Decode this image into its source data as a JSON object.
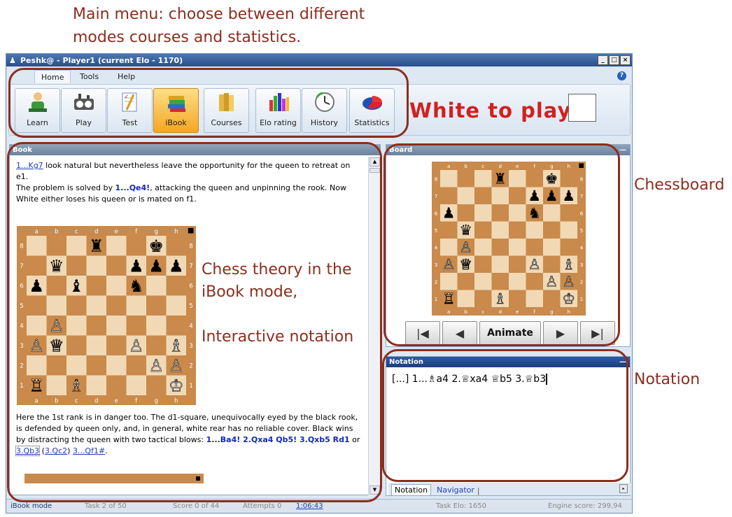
{
  "annotations": {
    "menu_line1": "Main menu: choose between different",
    "menu_line2": "modes courses and statistics.",
    "chessboard": "Chessboard",
    "notation": "Notation",
    "theory_line1": "Chess theory in  the",
    "theory_line2": "iBook mode,",
    "theory_line3": "Interactive notation"
  },
  "window": {
    "title": "Peshk@ - Player1 (current Elo - 1170)",
    "buttons": [
      "_",
      "□",
      "×"
    ]
  },
  "ribbon": {
    "tabs": [
      "Home",
      "Tools",
      "Help"
    ],
    "active_tab": "Home",
    "help_icon": "help-icon",
    "buttons": [
      {
        "label": "Learn",
        "icon": "learn-icon"
      },
      {
        "label": "Play",
        "icon": "clock-icon"
      },
      {
        "label": "Test",
        "icon": "test-icon"
      },
      {
        "label": "iBook",
        "icon": "books-icon"
      },
      {
        "label": "Courses",
        "icon": "course-books-icon"
      },
      {
        "label": "Elo rating",
        "icon": "bar-chart-icon"
      },
      {
        "label": "History",
        "icon": "history-clock-icon"
      },
      {
        "label": "Statistics",
        "icon": "pie-chart-icon"
      }
    ],
    "active_button": "iBook",
    "to_play": "White to play"
  },
  "book": {
    "title": "Book",
    "para1_link": "1...Kg7",
    "para1_rest": " look natural but nevertheless leave the opportunity for the queen to retreat on e1.",
    "para2_a": "The problem is solved by ",
    "para2_move": "1...Qe4!",
    "para2_b": ", attacking the queen and unpinning the rook. Now White either loses his queen or is mated on f1.",
    "para3": "Here the 1st rank is in danger too. The d1-square, unequivocally eyed by the black rook, is defended by queen only, and, in general, white rear has no reliable cover. Black wins by distracting the queen with two tactical blows: ",
    "para3_moves": "1...Ba4! 2.Qxa4 Qb5! 3.Qxb5 Rd1",
    "para3_or": " or ",
    "var1": "3.Qb3",
    "var2": "3.Qc2",
    "var3": "3...Qf1#",
    "period": "."
  },
  "board_panel": {
    "title": "Board",
    "animate": "Animate",
    "files": [
      "a",
      "b",
      "c",
      "d",
      "e",
      "f",
      "g",
      "h"
    ],
    "ranks": [
      "8",
      "7",
      "6",
      "5",
      "4",
      "3",
      "2",
      "1"
    ],
    "pieces": [
      [
        "d8",
        "r"
      ],
      [
        "g8",
        "k"
      ],
      [
        "b7",
        "q"
      ],
      [
        "f7",
        "p"
      ],
      [
        "g7",
        "p"
      ],
      [
        "h7",
        "p"
      ],
      [
        "a6",
        "p"
      ],
      [
        "c6",
        "b"
      ],
      [
        "f6",
        "n"
      ],
      [
        "b4",
        "P"
      ],
      [
        "a3",
        "P"
      ],
      [
        "b3",
        "Q"
      ],
      [
        "f3",
        "P"
      ],
      [
        "h3",
        "B"
      ],
      [
        "g2",
        "P"
      ],
      [
        "h2",
        "P"
      ],
      [
        "a1",
        "R"
      ],
      [
        "c1",
        "B"
      ],
      [
        "h1",
        "K"
      ]
    ],
    "small_pieces": [
      [
        "d8",
        "r"
      ],
      [
        "g8",
        "k"
      ],
      [
        "f7",
        "p"
      ],
      [
        "g7",
        "p"
      ],
      [
        "h7",
        "p"
      ],
      [
        "a6",
        "p"
      ],
      [
        "f6",
        "n"
      ],
      [
        "b5",
        "q"
      ],
      [
        "b4",
        "P"
      ],
      [
        "a3",
        "P"
      ],
      [
        "b3",
        "Q"
      ],
      [
        "f3",
        "P"
      ],
      [
        "h3",
        "B"
      ],
      [
        "g2",
        "P"
      ],
      [
        "h2",
        "P"
      ],
      [
        "a1",
        "R"
      ],
      [
        "d1",
        "B"
      ],
      [
        "h1",
        "K"
      ]
    ]
  },
  "notation_panel": {
    "title": "Notation",
    "text": "[...] 1...♗a4 2.♕xa4 ♕b5 3.♕b3",
    "tabs": [
      "Notation",
      "Navigator"
    ]
  },
  "status": {
    "mode": "iBook mode",
    "task": "Task 2 of 50",
    "score": "Score 0 of 44",
    "attempts": "Attempts 0",
    "time": "1:06:43",
    "task_elo": "Task Elo: 1650",
    "engine": "Engine score: 299,94"
  },
  "colors": {
    "annotation": "#8b2e1e",
    "to_play": "#d32020",
    "light_square": "#f1d9b5",
    "dark_square": "#c98a4b"
  }
}
